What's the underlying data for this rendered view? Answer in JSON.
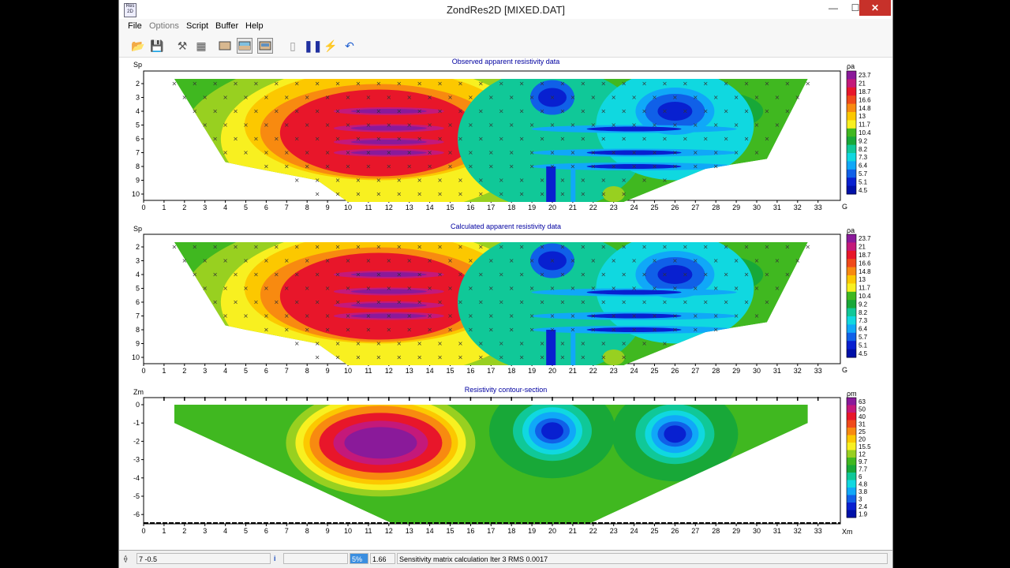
{
  "window": {
    "title": "ZondRes2D [MIXED.DAT]",
    "min": "—",
    "max": "☐",
    "close": "✕"
  },
  "menu": [
    "File",
    "Options",
    "Script",
    "Buffer",
    "Help"
  ],
  "toolbar": {
    "icons": [
      "open-folder-icon",
      "save-icon",
      "tools-icon",
      "table-icon",
      "section-view-icon",
      "section-view-icon",
      "section-view-icon",
      "page-icon",
      "pause-icon",
      "lightning-id-icon",
      "undo-icon"
    ]
  },
  "panels": [
    {
      "title": "Observed apparent resistivity data",
      "ylabel": "Sp",
      "xlabel": "G",
      "clabel": "ρa",
      "yticks": [
        "2",
        "3",
        "4",
        "5",
        "6",
        "7",
        "8",
        "9",
        "10"
      ],
      "cticks": [
        "23.7",
        "21",
        "18.7",
        "16.6",
        "14.8",
        "13",
        "11.7",
        "10.4",
        "9.2",
        "8.2",
        "7.3",
        "6.4",
        "5.7",
        "5.1",
        "4.5"
      ]
    },
    {
      "title": "Calculated apparent resistivity data",
      "ylabel": "Sp",
      "xlabel": "G",
      "clabel": "ρa",
      "yticks": [
        "2",
        "3",
        "4",
        "5",
        "6",
        "7",
        "8",
        "9",
        "10"
      ],
      "cticks": [
        "23.7",
        "21",
        "18.7",
        "16.6",
        "14.8",
        "13",
        "11.7",
        "10.4",
        "9.2",
        "8.2",
        "7.3",
        "6.4",
        "5.7",
        "5.1",
        "4.5"
      ]
    },
    {
      "title": "Resistivity contour-section",
      "ylabel": "Zm",
      "xlabel": "Xm",
      "clabel": "ρm",
      "yticks": [
        "0",
        "-1",
        "-2",
        "-3",
        "-4",
        "-5",
        "-6"
      ],
      "cticks": [
        "63",
        "50",
        "40",
        "31",
        "25",
        "20",
        "15.5",
        "12",
        "9.7",
        "7.7",
        "6",
        "4.8",
        "3.8",
        "3",
        "2.4",
        "1.9"
      ]
    }
  ],
  "xticks": [
    "0",
    "1",
    "2",
    "3",
    "4",
    "5",
    "6",
    "7",
    "8",
    "9",
    "10",
    "11",
    "12",
    "13",
    "14",
    "15",
    "16",
    "17",
    "18",
    "19",
    "20",
    "21",
    "22",
    "23",
    "24",
    "25",
    "26",
    "27",
    "28",
    "29",
    "30",
    "31",
    "32",
    "33"
  ],
  "colors": {
    "ramp": [
      "#8a1a9a",
      "#c4197a",
      "#e8162a",
      "#f04a1a",
      "#f88a10",
      "#fcc800",
      "#f8f020",
      "#98d020",
      "#40b820",
      "#18a838",
      "#10c898",
      "#10d8e0",
      "#10a8f8",
      "#1060e8",
      "#0820d0",
      "#0010a8"
    ]
  },
  "status": {
    "coords": "7 -0.5",
    "percent": "5%",
    "value": "1.66",
    "message": "Sensitivity matrix calculation Iter 3 RMS 0.0017"
  }
}
